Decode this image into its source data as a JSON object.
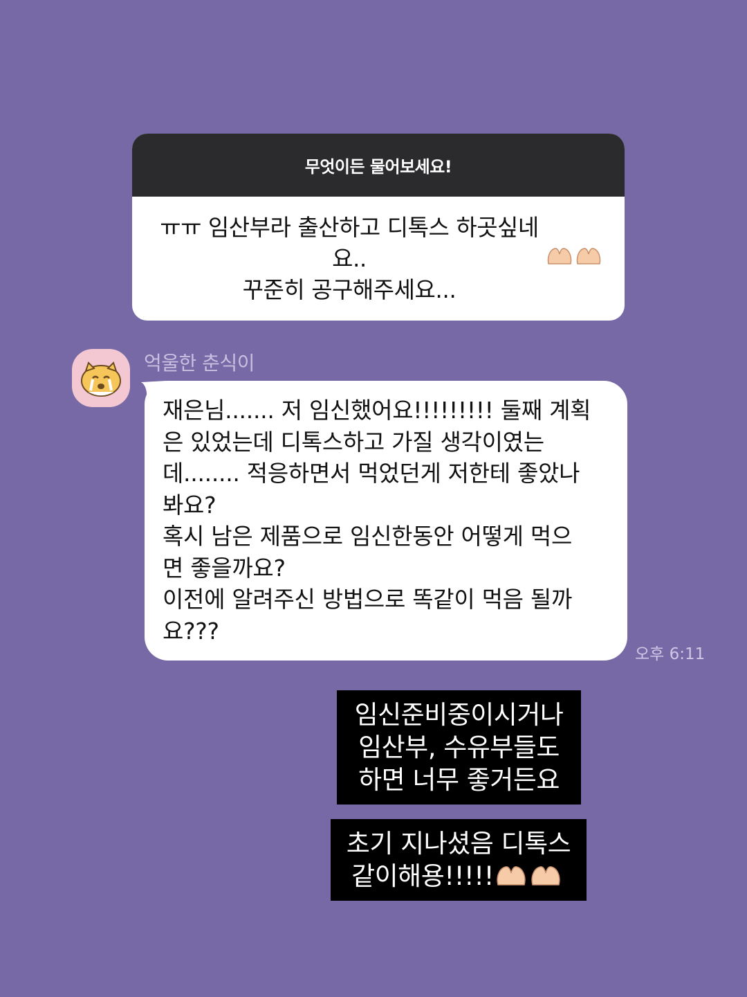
{
  "question_box": {
    "header": "무엇이든 물어보세요!",
    "body": "ㅠㅠ 임산부라 출산하고 디톡스 하곳싶네요..\n꾸준히 공구해주세요...",
    "emoji_icons": [
      "heart-hands-icon",
      "heart-hands-icon"
    ]
  },
  "chat": {
    "sender_name": "억울한 춘식이",
    "avatar_icon": "crying-cat-character-icon",
    "message": "재은님....... 저 임신했어요!!!!!!!!! 둘째 계획\n은 있었는데 디톡스하고 가질 생각이였는\n데........ 적응하면서 먹었던게 저한테 좋았나\n봐요?\n혹시 남은 제품으로 임신한동안 어떻게 먹으\n면 좋을까요?\n이전에 알려주신 방법으로 똑같이 먹음 될까\n요???",
    "timestamp": "오후 6:11"
  },
  "captions": {
    "first": "임신준비중이시거나\n임산부, 수유부들도\n하면 너무 좋거든요",
    "second": "초기 지나셨음 디톡스\n같이해용!!!!!",
    "emoji_icons": [
      "heart-hands-icon",
      "heart-hands-icon"
    ]
  },
  "colors": {
    "background": "#7669a5",
    "question_header": "#2b2b2d",
    "caption_background": "#000000"
  }
}
